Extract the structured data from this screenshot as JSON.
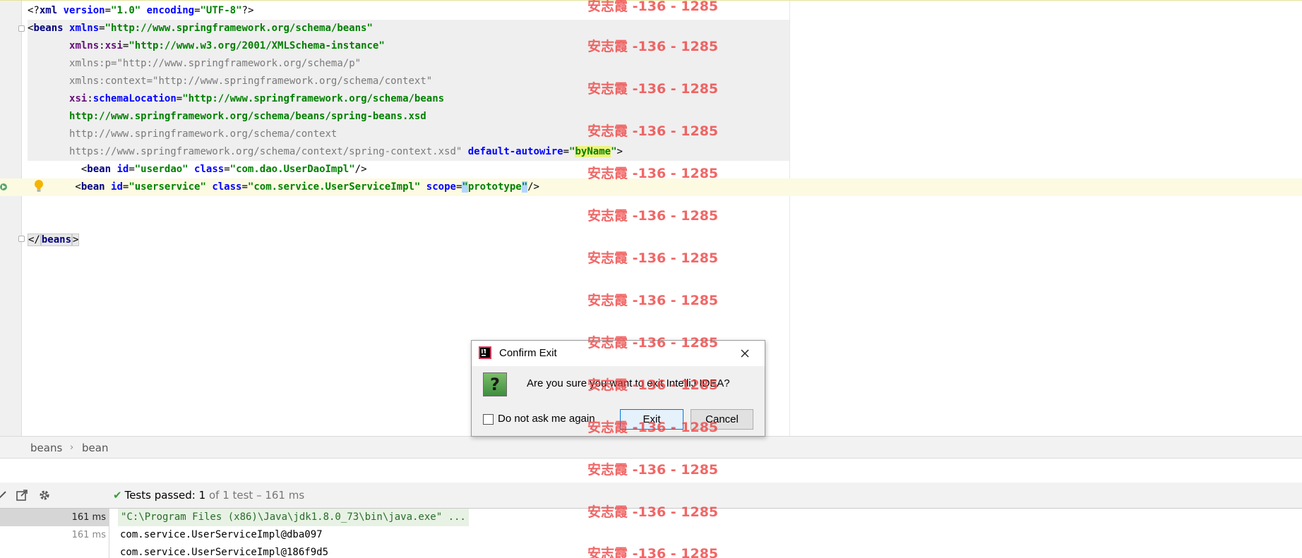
{
  "editor": {
    "lines": [
      {
        "parts": [
          [
            "tok-dim",
            "<?"
          ],
          [
            "tok-tag",
            "xml "
          ],
          [
            "tok-attr",
            "version"
          ],
          [
            "tok-dim",
            "="
          ],
          [
            "tok-val",
            "\"1.0\""
          ],
          [
            "tok-dim",
            " "
          ],
          [
            "tok-attr",
            "encoding"
          ],
          [
            "tok-dim",
            "="
          ],
          [
            "tok-val",
            "\"UTF-8\""
          ],
          [
            "tok-dim",
            "?>"
          ]
        ]
      },
      {
        "parts": [
          [
            "tok-dim",
            "<"
          ],
          [
            "tok-tag",
            "beans "
          ],
          [
            "tok-attr",
            "xmlns"
          ],
          [
            "tok-dim",
            "="
          ],
          [
            "tok-val",
            "\"http://www.springframework.org/schema/beans\""
          ]
        ]
      },
      {
        "parts": [
          [
            "tok-dim",
            "       "
          ],
          [
            "tok-ns",
            "xmlns"
          ],
          [
            "tok-dim",
            ":"
          ],
          [
            "tok-ns",
            "xsi"
          ],
          [
            "tok-dim",
            "="
          ],
          [
            "tok-val",
            "\"http://www.w3.org/2001/XMLSchema-instance\""
          ]
        ]
      },
      {
        "parts": [
          [
            "tok-dim",
            "       "
          ],
          [
            "tok-grey",
            "xmlns:p"
          ],
          [
            "tok-grey",
            "="
          ],
          [
            "tok-greyval",
            "\"http://www.springframework.org/schema/p\""
          ]
        ]
      },
      {
        "parts": [
          [
            "tok-dim",
            "       "
          ],
          [
            "tok-grey",
            "xmlns:context"
          ],
          [
            "tok-grey",
            "="
          ],
          [
            "tok-greyval",
            "\"http://www.springframework.org/schema/context\""
          ]
        ]
      },
      {
        "parts": [
          [
            "tok-dim",
            "       "
          ],
          [
            "tok-ns",
            "xsi"
          ],
          [
            "tok-dim",
            ":"
          ],
          [
            "tok-attr",
            "schemaLocation"
          ],
          [
            "tok-dim",
            "="
          ],
          [
            "tok-val",
            "\"http://www.springframework.org/schema/beans"
          ]
        ]
      },
      {
        "parts": [
          [
            "tok-dim",
            "       "
          ],
          [
            "tok-val",
            "http://www.springframework.org/schema/beans/spring-beans.xsd"
          ]
        ]
      },
      {
        "parts": [
          [
            "tok-dim",
            "       "
          ],
          [
            "tok-greyval",
            "http://www.springframework.org/schema/context"
          ]
        ]
      },
      {
        "parts": [
          [
            "tok-dim",
            "       "
          ],
          [
            "tok-greyval",
            "https://www.springframework.org/schema/context/spring-context.xsd\""
          ],
          [
            "tok-dim",
            " "
          ],
          [
            "tok-attr",
            "default-autowire"
          ],
          [
            "tok-dim",
            "="
          ],
          [
            "tok-val",
            "\""
          ],
          [
            "tok-val tok-hl",
            "byName"
          ],
          [
            "tok-val",
            "\""
          ],
          [
            "tok-dim",
            ">"
          ]
        ]
      },
      {
        "parts": [
          [
            "tok-dim",
            "         <"
          ],
          [
            "tok-tag",
            "bean "
          ],
          [
            "tok-attr",
            "id"
          ],
          [
            "tok-dim",
            "="
          ],
          [
            "tok-val",
            "\"userdao\""
          ],
          [
            "tok-dim",
            " "
          ],
          [
            "tok-attr",
            "class"
          ],
          [
            "tok-dim",
            "="
          ],
          [
            "tok-val",
            "\"com.dao.UserDaoImpl\""
          ],
          [
            "tok-dim",
            "/>"
          ]
        ]
      },
      {
        "parts": [
          [
            "tok-dim",
            "        <"
          ],
          [
            "tok-tag",
            "bean "
          ],
          [
            "tok-attr",
            "id"
          ],
          [
            "tok-dim",
            "="
          ],
          [
            "tok-val",
            "\"userservice\""
          ],
          [
            "tok-dim",
            " "
          ],
          [
            "tok-attr",
            "class"
          ],
          [
            "tok-dim",
            "="
          ],
          [
            "tok-val",
            "\"com.service.UserServiceImpl\""
          ],
          [
            "tok-dim",
            " "
          ],
          [
            "tok-attr",
            "scope"
          ],
          [
            "tok-dim",
            "="
          ],
          [
            "tok-val tok-caret",
            "\""
          ],
          [
            "tok-val",
            "prototype"
          ],
          [
            "tok-val tok-caret",
            "\""
          ],
          [
            "tok-dim",
            "/>"
          ]
        ]
      },
      {
        "parts": []
      },
      {
        "parts": []
      },
      {
        "parts": [
          [
            "tok-tagbox",
            "</"
          ],
          [
            "tok-tag tok-tagbox",
            "beans"
          ],
          [
            "tok-tagbox",
            ">"
          ]
        ]
      }
    ]
  },
  "breadcrumb": {
    "items": [
      "beans",
      "bean"
    ],
    "separator": "›"
  },
  "run": {
    "status": {
      "label": "Tests passed:",
      "count": "1",
      "detail": "of 1 test – 161 ms"
    },
    "timings": [
      "161 ms",
      "161 ms"
    ],
    "console": [
      "\"C:\\Program Files (x86)\\Java\\jdk1.8.0_73\\bin\\java.exe\" ...",
      "com.service.UserServiceImpl@dba097",
      "com.service.UserServiceImpl@186f9d5"
    ]
  },
  "dialog": {
    "title": "Confirm Exit",
    "message": "Are you sure you want to exit IntelliJ IDEA?",
    "checkbox_label": "Do not ask me again",
    "exit_label": "Exit",
    "cancel_label": "Cancel",
    "question_glyph": "?"
  },
  "watermark": {
    "text": "安志霞 -136 - 1285"
  },
  "colors": {
    "accent": "#0078d7",
    "success": "#3a9d3a",
    "watermark": "#ee4646"
  }
}
